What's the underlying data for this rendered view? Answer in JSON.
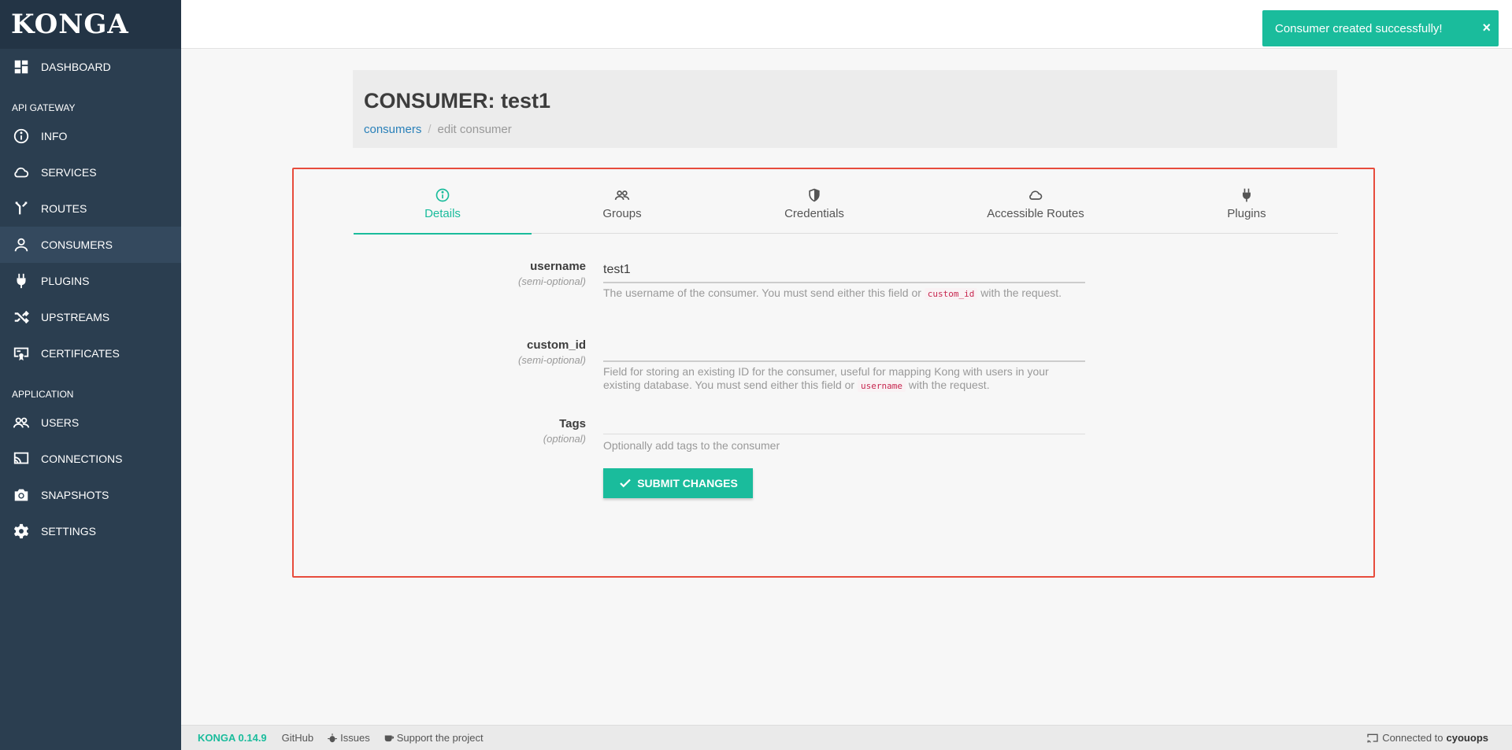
{
  "app": {
    "logo": "KONGA"
  },
  "sidebar": {
    "dashboard": "DASHBOARD",
    "section_gateway": "API GATEWAY",
    "gateway_items": [
      {
        "label": "INFO",
        "icon": "info-icon"
      },
      {
        "label": "SERVICES",
        "icon": "cloud-icon"
      },
      {
        "label": "ROUTES",
        "icon": "routes-icon"
      },
      {
        "label": "CONSUMERS",
        "icon": "user-icon"
      },
      {
        "label": "PLUGINS",
        "icon": "plug-icon"
      },
      {
        "label": "UPSTREAMS",
        "icon": "shuffle-icon"
      },
      {
        "label": "CERTIFICATES",
        "icon": "certificate-icon"
      }
    ],
    "section_application": "APPLICATION",
    "application_items": [
      {
        "label": "USERS",
        "icon": "users-icon"
      },
      {
        "label": "CONNECTIONS",
        "icon": "connections-icon"
      },
      {
        "label": "SNAPSHOTS",
        "icon": "camera-icon"
      },
      {
        "label": "SETTINGS",
        "icon": "gear-icon"
      }
    ]
  },
  "toast": {
    "message": "Consumer created successfully!",
    "close": "×"
  },
  "header": {
    "title": "CONSUMER: test1",
    "breadcrumb_link": "consumers",
    "breadcrumb_separator": "/",
    "breadcrumb_current": "edit consumer"
  },
  "tabs": [
    {
      "label": "Details",
      "icon": "info-icon"
    },
    {
      "label": "Groups",
      "icon": "users-icon"
    },
    {
      "label": "Credentials",
      "icon": "shield-icon"
    },
    {
      "label": "Accessible Routes",
      "icon": "cloud-icon"
    },
    {
      "label": "Plugins",
      "icon": "plug-icon"
    }
  ],
  "form": {
    "username": {
      "label": "username",
      "hint": "(semi-optional)",
      "value": "test1",
      "help_before": "The username of the consumer. You must send either this field or ",
      "help_code": "custom_id",
      "help_after": " with the request."
    },
    "custom_id": {
      "label": "custom_id",
      "hint": "(semi-optional)",
      "value": "",
      "help_before": "Field for storing an existing ID for the consumer, useful for mapping Kong with users in your existing database. You must send either this field or ",
      "help_code": "username",
      "help_after": " with the request."
    },
    "tags": {
      "label": "Tags",
      "hint": "(optional)",
      "help": "Optionally add tags to the consumer"
    },
    "submit_label": "SUBMIT CHANGES"
  },
  "footer": {
    "version": "KONGA 0.14.9",
    "github": "GitHub",
    "issues": "Issues",
    "support": "Support the project",
    "connected_prefix": "Connected to",
    "connected_name": "cyouops"
  },
  "colors": {
    "accent": "#1abc9c",
    "sidebar": "#2b3e50",
    "highlight_border": "#e74c3c"
  }
}
